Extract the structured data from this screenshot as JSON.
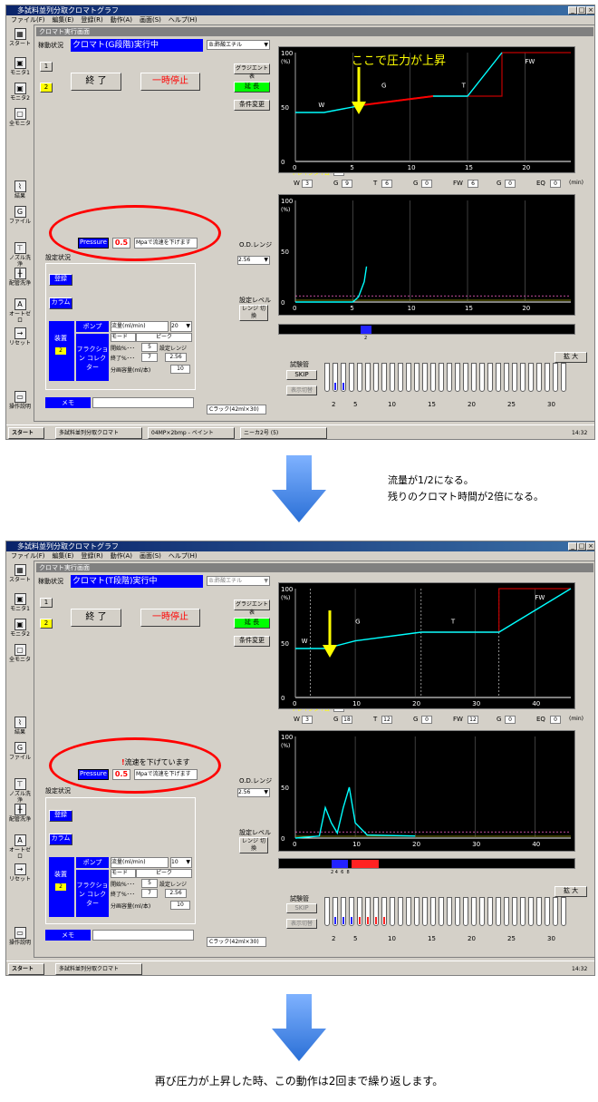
{
  "window_title": "多試料並列分取クロマトグラフ",
  "menu": [
    "ファイル(F)",
    "編集(E)",
    "登録(R)",
    "動作(A)",
    "画面(S)",
    "ヘルプ(H)"
  ],
  "sidebar": [
    {
      "label": "スタート",
      "icon": "start-icon"
    },
    {
      "label": "モニタ1",
      "icon": "monitor-icon"
    },
    {
      "label": "モニタ2",
      "icon": "monitor-icon"
    },
    {
      "label": "全モニタ",
      "icon": "monitor-icon"
    },
    {
      "label": "結果",
      "icon": "chart-icon"
    },
    {
      "label": "ファイル",
      "icon": "file-icon"
    },
    {
      "label": "ノズル洗浄",
      "icon": "nozzle-icon"
    },
    {
      "label": "配管洗浄",
      "icon": "pipe-icon"
    },
    {
      "label": "オートゼロ",
      "icon": "auto-icon"
    },
    {
      "label": "リセット",
      "icon": "reset-icon"
    },
    {
      "label": "操作説明",
      "icon": "help-icon"
    }
  ],
  "common": {
    "panel_title": "クロマト実行画面",
    "status_label": "稼動状況",
    "solvent": "B:酢酸エチル",
    "btn_1": "1",
    "btn_2": "2",
    "end": "終 了",
    "pause": "一時停止",
    "gradient": "グラジエント表",
    "extend": "延 長",
    "condition": "条件変更",
    "drain_label": "ドレインタイム",
    "drain_value": "0",
    "drain_unit": "min",
    "pressure_label": "Pressure",
    "pressure_value": "0.5",
    "pressure_msg": "Mpaで流速を下げます",
    "settings_label": "設定状況",
    "register": "登録",
    "column": "カラム",
    "device": "装置",
    "device_no": "2",
    "pump": "ポンプ",
    "flow_label": "流量(ml/min)",
    "fraction": "フラクション コレクター",
    "mode": "モード",
    "peak": "ピーク",
    "start_pct": "開始%･･･",
    "start_val": "5",
    "end_pct": "終了%･･･",
    "end_val": "7",
    "range_label": "設定レンジ",
    "range_val": "2.56",
    "split_vol": "分画容量(ml/本)",
    "split_val": "10",
    "memo": "メモ",
    "od_range": "O.D.レンジ",
    "od_val": "2.56",
    "setlevel": "設定レベル",
    "range_switch": "レンジ 切換",
    "tubes_label": "試験管",
    "skip": "SKIP",
    "display_switch": "表示切替",
    "enlarge": "拡 大",
    "rack": "Cラック(42ml×30)",
    "min_unit": "(min)",
    "pct_unit": "(%)",
    "phase_w": "W",
    "phase_g": "G",
    "phase_t": "T",
    "phase_fw": "FW",
    "tube_ticks": [
      "2",
      "5",
      "10",
      "15",
      "20",
      "25",
      "30"
    ],
    "eq_labels": [
      "W",
      "G",
      "T",
      "G",
      "FW",
      "G",
      "EQ"
    ],
    "y100": "100",
    "y50": "50",
    "y0": "0"
  },
  "screen1": {
    "status": "クロマト(G段階)実行中",
    "flow_val": "20",
    "annotation": "ここで圧力が上昇",
    "x_ticks": [
      "0",
      "5",
      "10",
      "15",
      "20"
    ],
    "eq_values": [
      "3",
      "9",
      "6",
      "0",
      "6",
      "0",
      "0"
    ],
    "uv_ticks": [
      "0",
      "5",
      "10",
      "15",
      "20"
    ],
    "fraction_tick": "2",
    "taskbar": [
      "スタート",
      "多試料並列分取クロマト",
      "04MP×2bmp - ペイント",
      "ニーカ2号 (5)"
    ],
    "clock": "14:32"
  },
  "screen2": {
    "status": "クロマト(T段階)実行中",
    "flow_val": "10",
    "warning": "流速を下げています",
    "x_ticks": [
      "0",
      "10",
      "20",
      "30",
      "40"
    ],
    "eq_values": [
      "3",
      "18",
      "12",
      "0",
      "12",
      "0",
      "0"
    ],
    "uv_ticks": [
      "0",
      "10",
      "20",
      "30",
      "40"
    ],
    "fraction_ticks": "2 4  6  8",
    "taskbar": [
      "スタート",
      "多試料並列分取クロマト"
    ],
    "clock": "14:32"
  },
  "notes": {
    "middle_line1": "流量が1/2になる。",
    "middle_line2": "残りのクロマト時間が2倍になる。",
    "bottom": "再び圧力が上昇した時、この動作は2回まで繰り返します。"
  },
  "chart_data": [
    {
      "type": "line",
      "title": "",
      "x": [
        0,
        2.5,
        6,
        12,
        15,
        18
      ],
      "values": [
        45,
        45,
        52,
        60,
        60,
        100
      ],
      "xlim": [
        0,
        24
      ],
      "ylim": [
        0,
        100
      ],
      "xlabel": "(min)",
      "ylabel": "(%)"
    },
    {
      "type": "line",
      "title": "",
      "x": [
        0,
        5,
        5.5,
        6,
        6.2
      ],
      "values": [
        0,
        0,
        5,
        20,
        35
      ],
      "xlim": [
        0,
        24
      ],
      "ylim": [
        0,
        100
      ],
      "xlabel": "",
      "ylabel": "(%)"
    },
    {
      "type": "line",
      "title": "",
      "x": [
        0,
        5,
        10,
        21,
        34,
        46
      ],
      "values": [
        45,
        45,
        52,
        60,
        60,
        100
      ],
      "xlim": [
        0,
        46
      ],
      "ylim": [
        0,
        100
      ],
      "xlabel": "(min)",
      "ylabel": "(%)"
    },
    {
      "type": "line",
      "title": "",
      "x": [
        0,
        4,
        5,
        6,
        7,
        8,
        9,
        10,
        12,
        20
      ],
      "values": [
        0,
        2,
        30,
        15,
        5,
        30,
        50,
        15,
        3,
        2
      ],
      "xlim": [
        0,
        46
      ],
      "ylim": [
        0,
        100
      ],
      "xlabel": "",
      "ylabel": "(%)"
    }
  ]
}
